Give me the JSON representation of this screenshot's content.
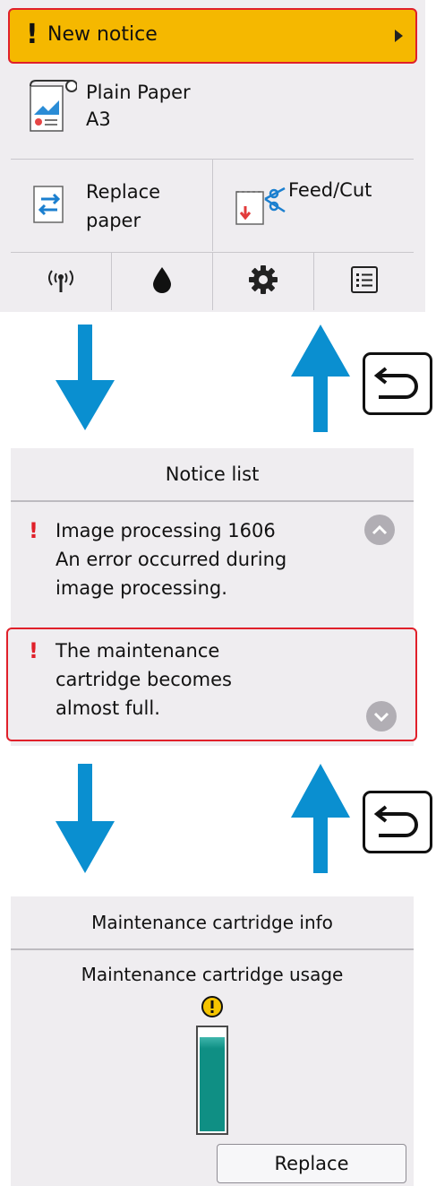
{
  "home": {
    "notice_label": "New notice",
    "paper_type": "Plain Paper",
    "paper_size": "A3",
    "replace_line1": "Replace",
    "replace_line2": "paper",
    "feed_cut": "Feed/Cut",
    "icons": [
      "wireless-icon",
      "ink-drop-icon",
      "gear-icon",
      "list-icon"
    ]
  },
  "notice_list": {
    "title": "Notice list",
    "items": [
      {
        "lines": [
          "Image processing 1606",
          "An error occurred during",
          "image processing."
        ],
        "selected": false
      },
      {
        "lines": [
          "The maintenance",
          "cartridge becomes",
          "almost full."
        ],
        "selected": true
      }
    ]
  },
  "maintenance_info": {
    "title": "Maintenance cartridge info",
    "usage_label": "Maintenance cartridge usage",
    "usage_fraction": 0.92,
    "warning_icon": "warning-icon",
    "replace_label": "Replace"
  },
  "colors": {
    "notice_bg": "#f5b800",
    "alert_red": "#e0202a",
    "arrow_blue": "#0a8fd0",
    "gauge_teal": "#0f8f84",
    "panel_bg": "#efedf0"
  }
}
